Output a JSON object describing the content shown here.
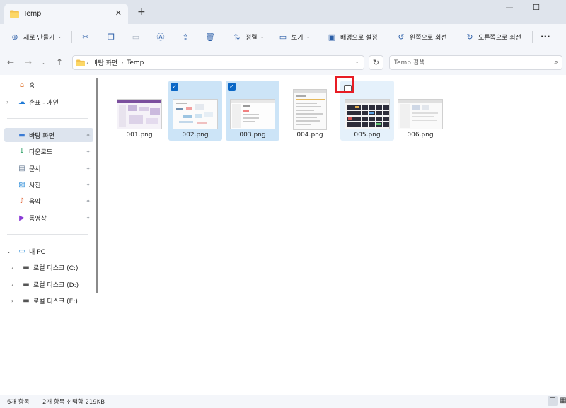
{
  "window": {
    "tab_title": "Temp",
    "tab_folder_icon": "folder-icon",
    "close_tab_symbol": "✕",
    "new_tab_symbol": "+",
    "minimize_symbol": "—",
    "maximize_symbol": "☐"
  },
  "toolbar": {
    "new_label": "새로 만들기",
    "sort_label": "정렬",
    "view_label": "보기",
    "set_background_label": "배경으로 설정",
    "rotate_left_label": "왼쪽으로 회전",
    "rotate_right_label": "오른쪽으로 회전",
    "more_symbol": "···"
  },
  "address": {
    "breadcrumbs": [
      "바탕 화면",
      "Temp"
    ],
    "search_placeholder": "Temp 검색"
  },
  "sidebar": {
    "home": "홈",
    "onedrive": "손표 - 개인",
    "quick_access": [
      {
        "label": "바탕 화면",
        "icon": "desktop-icon",
        "selected": true
      },
      {
        "label": "다운로드",
        "icon": "download-icon",
        "selected": false
      },
      {
        "label": "문서",
        "icon": "document-icon",
        "selected": false
      },
      {
        "label": "사진",
        "icon": "pictures-icon",
        "selected": false
      },
      {
        "label": "음악",
        "icon": "music-icon",
        "selected": false
      },
      {
        "label": "동영상",
        "icon": "video-icon",
        "selected": false
      }
    ],
    "this_pc": "내 PC",
    "drives": [
      {
        "label": "로컬 디스크 (C:)",
        "icon": "drive-c-icon"
      },
      {
        "label": "로컬 디스크 (D:)",
        "icon": "drive-icon"
      },
      {
        "label": "로컬 디스크 (E:)",
        "icon": "drive-icon"
      }
    ]
  },
  "files": [
    {
      "name": "001.png",
      "state": "normal",
      "checkbox": "none"
    },
    {
      "name": "002.png",
      "state": "selected",
      "checkbox": "checked"
    },
    {
      "name": "003.png",
      "state": "selected",
      "checkbox": "checked"
    },
    {
      "name": "004.png",
      "state": "normal",
      "checkbox": "none"
    },
    {
      "name": "005.png",
      "state": "hover",
      "checkbox": "unchecked"
    },
    {
      "name": "006.png",
      "state": "normal",
      "checkbox": "none"
    }
  ],
  "status": {
    "item_count": "6개 항목",
    "selection": "2개 항목 선택함 219KB"
  },
  "colors": {
    "accent": "#0a67c6",
    "selection_bg": "#cce4f7",
    "hover_bg": "#e5f1fb",
    "highlight_box": "#e81c24"
  }
}
